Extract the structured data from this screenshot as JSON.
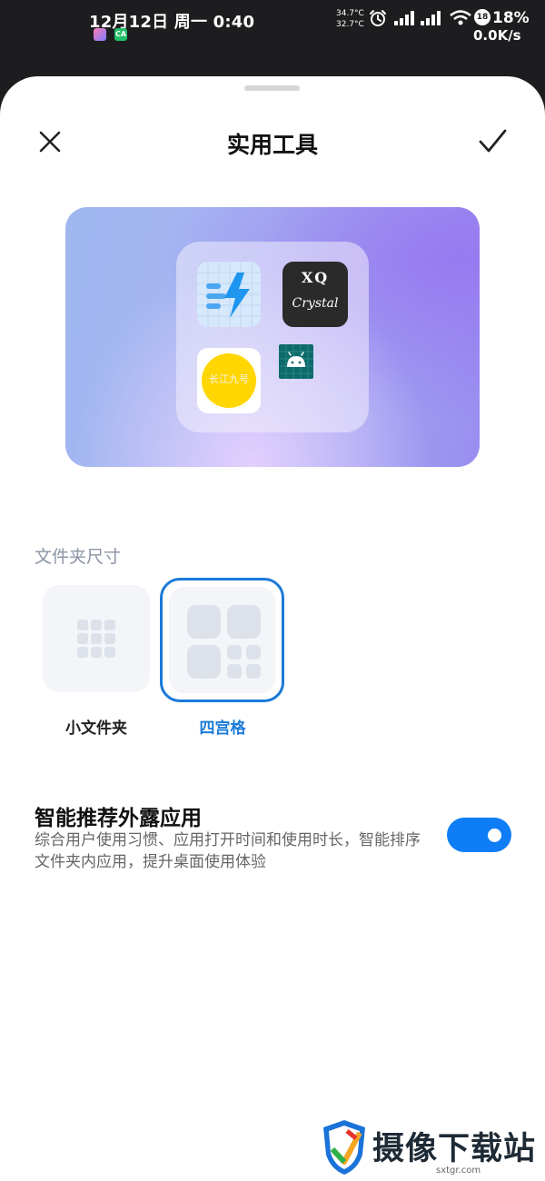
{
  "status_bar": {
    "time": "12月12日 周一 0:40",
    "temp_1": "34.7°C",
    "temp_2": "32.7°C",
    "battery_badge": "18",
    "battery_pct": "18%",
    "net_speed": "0.0K/s",
    "mini_icon_b": "CA"
  },
  "header": {
    "title": "实用工具",
    "close_icon": "close-icon",
    "confirm_icon": "check-icon"
  },
  "preview": {
    "apps": [
      {
        "name": "flash-app-icon"
      },
      {
        "name": "xq-crystal-app-icon",
        "text_top": "XQ",
        "text_bottom": "Crystal"
      },
      {
        "name": "yellow-circle-app-icon",
        "text": "长江九号"
      },
      {
        "name": "android-app-icon"
      }
    ]
  },
  "folder_size": {
    "label": "文件夹尺寸",
    "options": [
      {
        "label": "小文件夹",
        "selected": false
      },
      {
        "label": "四宫格",
        "selected": true
      }
    ]
  },
  "smart": {
    "title": "智能推荐外露应用",
    "description": "综合用户使用习惯、应用打开时间和使用时长，智能排序文件夹内应用，提升桌面使用体验",
    "enabled": true
  },
  "watermark": {
    "text": "摄像下载站",
    "url": "sxtgr.com"
  },
  "colors": {
    "accent": "#1a7ad8",
    "toggle_on": "#0f7ef6"
  }
}
